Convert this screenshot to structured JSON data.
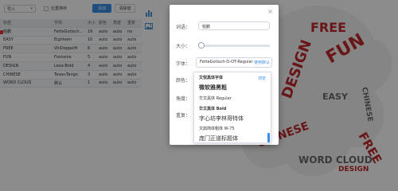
{
  "toolbar": {
    "select_value": "导入",
    "checkbox_label": "比重排序",
    "add_label": "添加",
    "clear_label": "清除值"
  },
  "table": {
    "headers": [
      "标签",
      "字体",
      "大小",
      "颜色",
      "角度",
      "重复"
    ],
    "rows": [
      [
        "柏鹏",
        "FetteGotisch...",
        "16",
        "auto",
        "auto",
        "no"
      ],
      [
        "EASY",
        "Eighteen",
        "10",
        "auto",
        "auto",
        "auto"
      ],
      [
        "FREE",
        "VinDoppelH",
        "6",
        "auto",
        "auto",
        "auto"
      ],
      [
        "FUN",
        "Fontanie",
        "5",
        "auto",
        "auto",
        "auto"
      ],
      [
        "DESIGN",
        "Lexa-Bold",
        "4",
        "auto",
        "auto",
        "auto"
      ],
      [
        "CHINESE",
        "Texas-Tango",
        "3",
        "auto",
        "auto",
        "auto"
      ],
      [
        "WORD CLOUD",
        "默认",
        "1",
        "auto",
        "auto",
        "auto"
      ]
    ]
  },
  "modal": {
    "label_text": "词语：",
    "text_value": "柏鹏",
    "label_size": "大小：",
    "label_font": "字体：",
    "font_value": "FetteGotisch-D-OT-Regular",
    "font_link": "使用默认",
    "label_color": "颜色：",
    "label_angle": "角度：",
    "label_repeat": "重复：",
    "close_glyph": "×"
  },
  "dropdown": {
    "header_label": "文悦黑体字体",
    "header_link": "浏览",
    "options": [
      "微软雅黑粗",
      "华文黑体 Regular",
      "华文黑体 Bold",
      "字心坊李林哥特体",
      "文鼎简体粗体 W-75",
      "庞门正道标题体"
    ]
  },
  "wordcloud": {
    "words": [
      "FREE",
      "FUN",
      "DESIGN",
      "EASY",
      "CHINESE",
      "WORD CLOUD"
    ]
  },
  "colors": {
    "accent": "#3a8ee6",
    "cloud_red": "#c0282d",
    "cloud_gray": "#6b6b6b"
  }
}
